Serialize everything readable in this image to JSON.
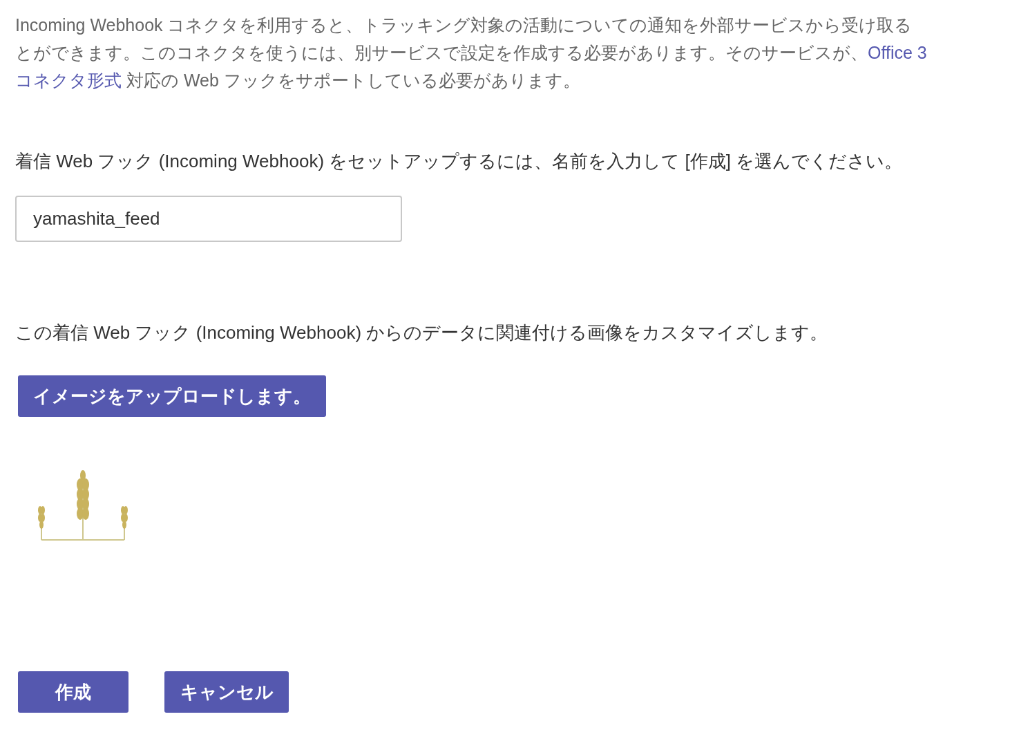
{
  "intro": {
    "lines": [
      [
        {
          "text": "Incoming Webhook コネクタを利用すると、トラッキング対象の活動についての通知を外部サービスから受け取る",
          "link": false
        }
      ],
      [
        {
          "text": "とができます。このコネクタを使うには、別サービスで設定を作成する必要があります。そのサービスが、",
          "link": false
        },
        {
          "text": "Office 3",
          "link": true
        }
      ],
      [
        {
          "text": "コネクタ形式",
          "link": true
        },
        {
          "text": " 対応の Web フックをサポートしている必要があります。",
          "link": false
        }
      ]
    ]
  },
  "name_prompt": "着信 Web フック (Incoming Webhook) をセットアップするには、名前を入力して [作成] を選んでください。",
  "name_field": {
    "value": "yamashita_feed"
  },
  "image_prompt": "この着信 Web フック (Incoming Webhook) からのデータに関連付ける画像をカスタマイズします。",
  "upload_button": "イメージをアップロードします。",
  "buttons": [
    {
      "label": "作成",
      "kind": "create"
    },
    {
      "label": "キャンセル",
      "kind": "cancel"
    }
  ]
}
